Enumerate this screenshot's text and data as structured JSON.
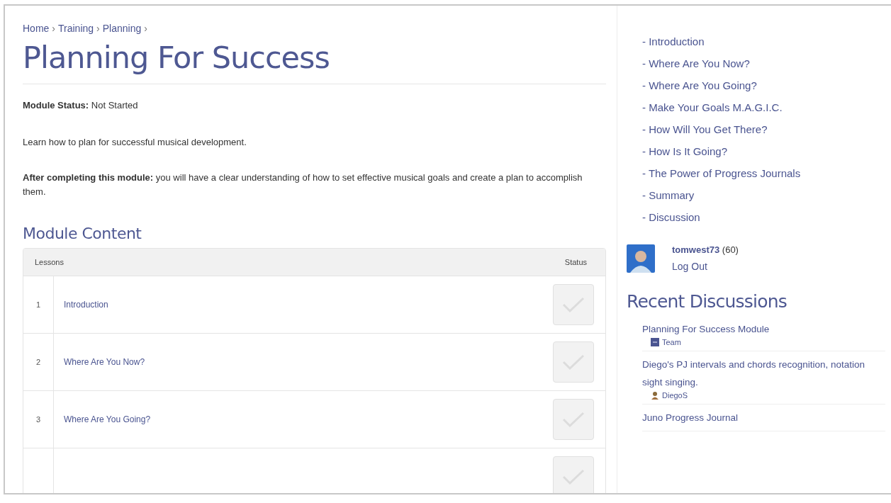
{
  "breadcrumb": [
    "Home",
    "Training",
    "Planning"
  ],
  "breadcrumb_separator": "›",
  "title": "Planning For Success",
  "status_line": "**Module Status:** Not Started",
  "description": "Learn how to plan for successful musical development.",
  "outcome": "**After completing this module:** you will have a clear understanding of how to set effective musical goals and create a plan to accomplish them.",
  "content_heading": "Module Content",
  "table": {
    "columns": [
      "Lessons",
      "Status"
    ],
    "rows": [
      {
        "number": "1",
        "title": "Introduction",
        "completed": false
      },
      {
        "number": "2",
        "title": "Where Are You Now?",
        "completed": false
      },
      {
        "number": "3",
        "title": "Where Are You Going?",
        "completed": false
      },
      {
        "completed": false
      }
    ]
  },
  "sidebar": {
    "lessons": [
      "- Introduction",
      "- Where Are You Now?",
      "- Where Are You Going?",
      "- Make Your Goals M.A.G.I.C.",
      "- How Will You Get There?",
      "- How Is It Going?",
      "- The Power of Progress Journals",
      "- Summary",
      "- Discussion"
    ],
    "user": {
      "name": "tomwest73",
      "points": "(60)",
      "logout": "Log Out"
    },
    "discussions_heading": "Recent Discussions",
    "discussions": [
      {
        "title": "Planning For Success Module",
        "author": "Team",
        "kind": "group"
      },
      {
        "title": "Diego's PJ intervals and chords recognition, notation sight singing.",
        "author": "DiegoS",
        "kind": "person"
      },
      {
        "title": "Juno Progress Journal"
      }
    ]
  }
}
